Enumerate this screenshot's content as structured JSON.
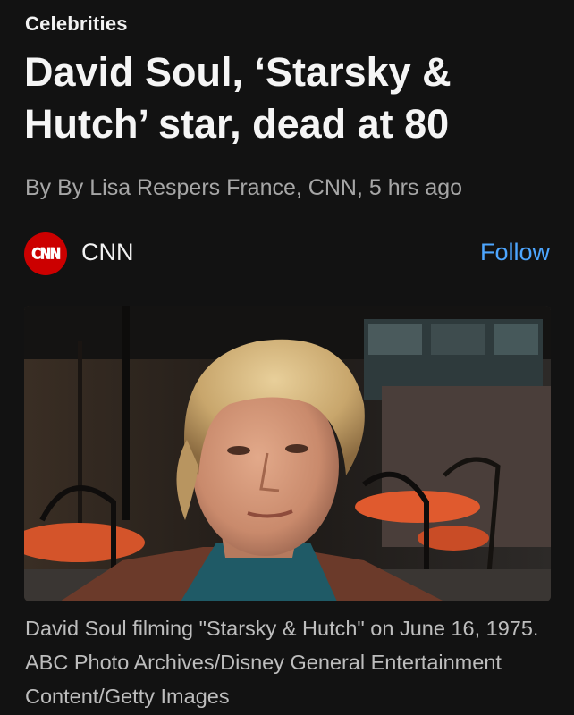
{
  "article": {
    "category": "Celebrities",
    "headline": "David Soul, ‘Starsky & Hutch’ star, dead at 80",
    "byline": "By By Lisa Respers France, CNN, 5 hrs ago"
  },
  "source": {
    "logo_text": "CNN",
    "name": "CNN",
    "follow_label": "Follow",
    "brand_color": "#cc0000",
    "follow_color": "#4da6ff"
  },
  "image": {
    "caption": "David Soul filming \"Starsky & Hutch\" on June 16, 1975. ABC Photo Archives/Disney General Entertainment Content/Getty Images"
  }
}
